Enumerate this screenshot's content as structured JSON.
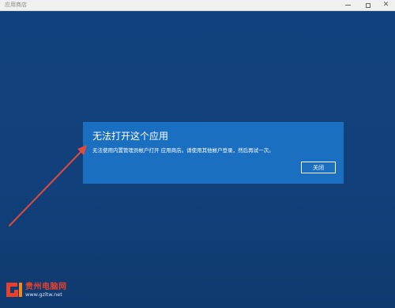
{
  "window": {
    "title": "应用商店",
    "controls": {
      "minimize_icon": "minimize-icon",
      "maximize_icon": "maximize-icon",
      "close_icon": "close-icon",
      "close_glyph": "✕"
    }
  },
  "dialog": {
    "title": "无法打开这个应用",
    "message": "无法使用内置管理员帐户打开 应用商店。请使用其他帐户登录，然后再试一次。",
    "close_button": "关闭"
  },
  "watermark": {
    "name": "贵州电脑网",
    "url": "www.gzltw.net"
  },
  "colors": {
    "background": "#12427c",
    "dialog": "#1b6fc0",
    "arrow": "#e04a3c",
    "watermark_red": "#e8412b"
  }
}
